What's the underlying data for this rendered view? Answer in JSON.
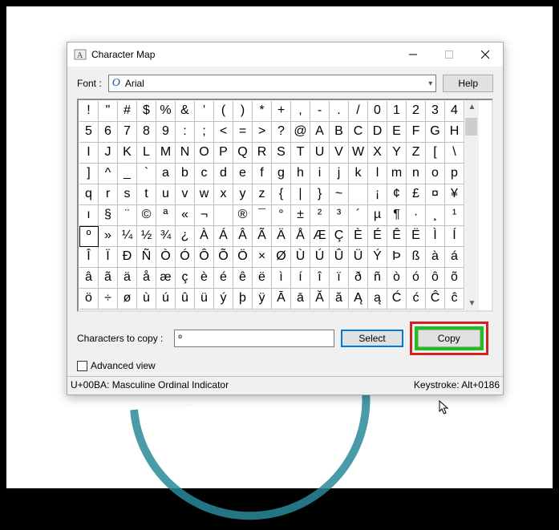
{
  "window": {
    "title": "Character Map"
  },
  "font": {
    "label": "Font :",
    "name": "Arial",
    "help": "Help"
  },
  "grid": {
    "chars": [
      "!",
      "\"",
      "#",
      "$",
      "%",
      "&",
      "'",
      "(",
      ")",
      "*",
      "+",
      ",",
      "-",
      ".",
      "/",
      "0",
      "1",
      "2",
      "3",
      "4",
      "5",
      "6",
      "7",
      "8",
      "9",
      ":",
      ";",
      "<",
      "=",
      ">",
      "?",
      "@",
      "A",
      "B",
      "C",
      "D",
      "E",
      "F",
      "G",
      "H",
      "I",
      "J",
      "K",
      "L",
      "M",
      "N",
      "O",
      "P",
      "Q",
      "R",
      "S",
      "T",
      "U",
      "V",
      "W",
      "X",
      "Y",
      "Z",
      "[",
      "\\",
      "]",
      "^",
      "_",
      "`",
      "a",
      "b",
      "c",
      "d",
      "e",
      "f",
      "g",
      "h",
      "i",
      "j",
      "k",
      "l",
      "m",
      "n",
      "o",
      "p",
      "q",
      "r",
      "s",
      "t",
      "u",
      "v",
      "w",
      "x",
      "y",
      "z",
      "{",
      "|",
      "}",
      "~",
      " ",
      "¡",
      "¢",
      "£",
      "¤",
      "¥",
      "ı",
      "§",
      "¨",
      "©",
      "ª",
      "«",
      "¬",
      "­",
      "®",
      "¯",
      "°",
      "±",
      "²",
      "³",
      "´",
      "µ",
      "¶",
      "·",
      "¸",
      "¹",
      "º",
      "»",
      "¼",
      "½",
      "¾",
      "¿",
      "À",
      "Á",
      "Â",
      "Ã",
      "Ä",
      "Å",
      "Æ",
      "Ç",
      "È",
      "É",
      "Ê",
      "Ë",
      "Ì",
      "Í",
      "Î",
      "Ï",
      "Đ",
      "Ñ",
      "Ò",
      "Ó",
      "Ô",
      "Õ",
      "Ö",
      "×",
      "Ø",
      "Ù",
      "Ú",
      "Û",
      "Ü",
      "Ý",
      "Þ",
      "ß",
      "à",
      "á",
      "â",
      "ã",
      "ä",
      "å",
      "æ",
      "ç",
      "è",
      "é",
      "ê",
      "ë",
      "ì",
      "í",
      "î",
      "ï",
      "ð",
      "ñ",
      "ò",
      "ó",
      "ô",
      "õ",
      "ö",
      "÷",
      "ø",
      "ù",
      "ú",
      "û",
      "ü",
      "ý",
      "þ",
      "ÿ",
      "Ā",
      "ā",
      "Ă",
      "ă",
      "Ą",
      "ą",
      "Ć",
      "ć",
      "Ĉ",
      "ĉ"
    ],
    "selected_index": 120
  },
  "copy": {
    "label": "Characters to copy :",
    "value": "º",
    "select": "Select",
    "copy": "Copy"
  },
  "advanced": {
    "label": "Advanced view",
    "checked": false
  },
  "status": {
    "left": "U+00BA: Masculine Ordinal Indicator",
    "right": "Keystroke: Alt+0186"
  }
}
